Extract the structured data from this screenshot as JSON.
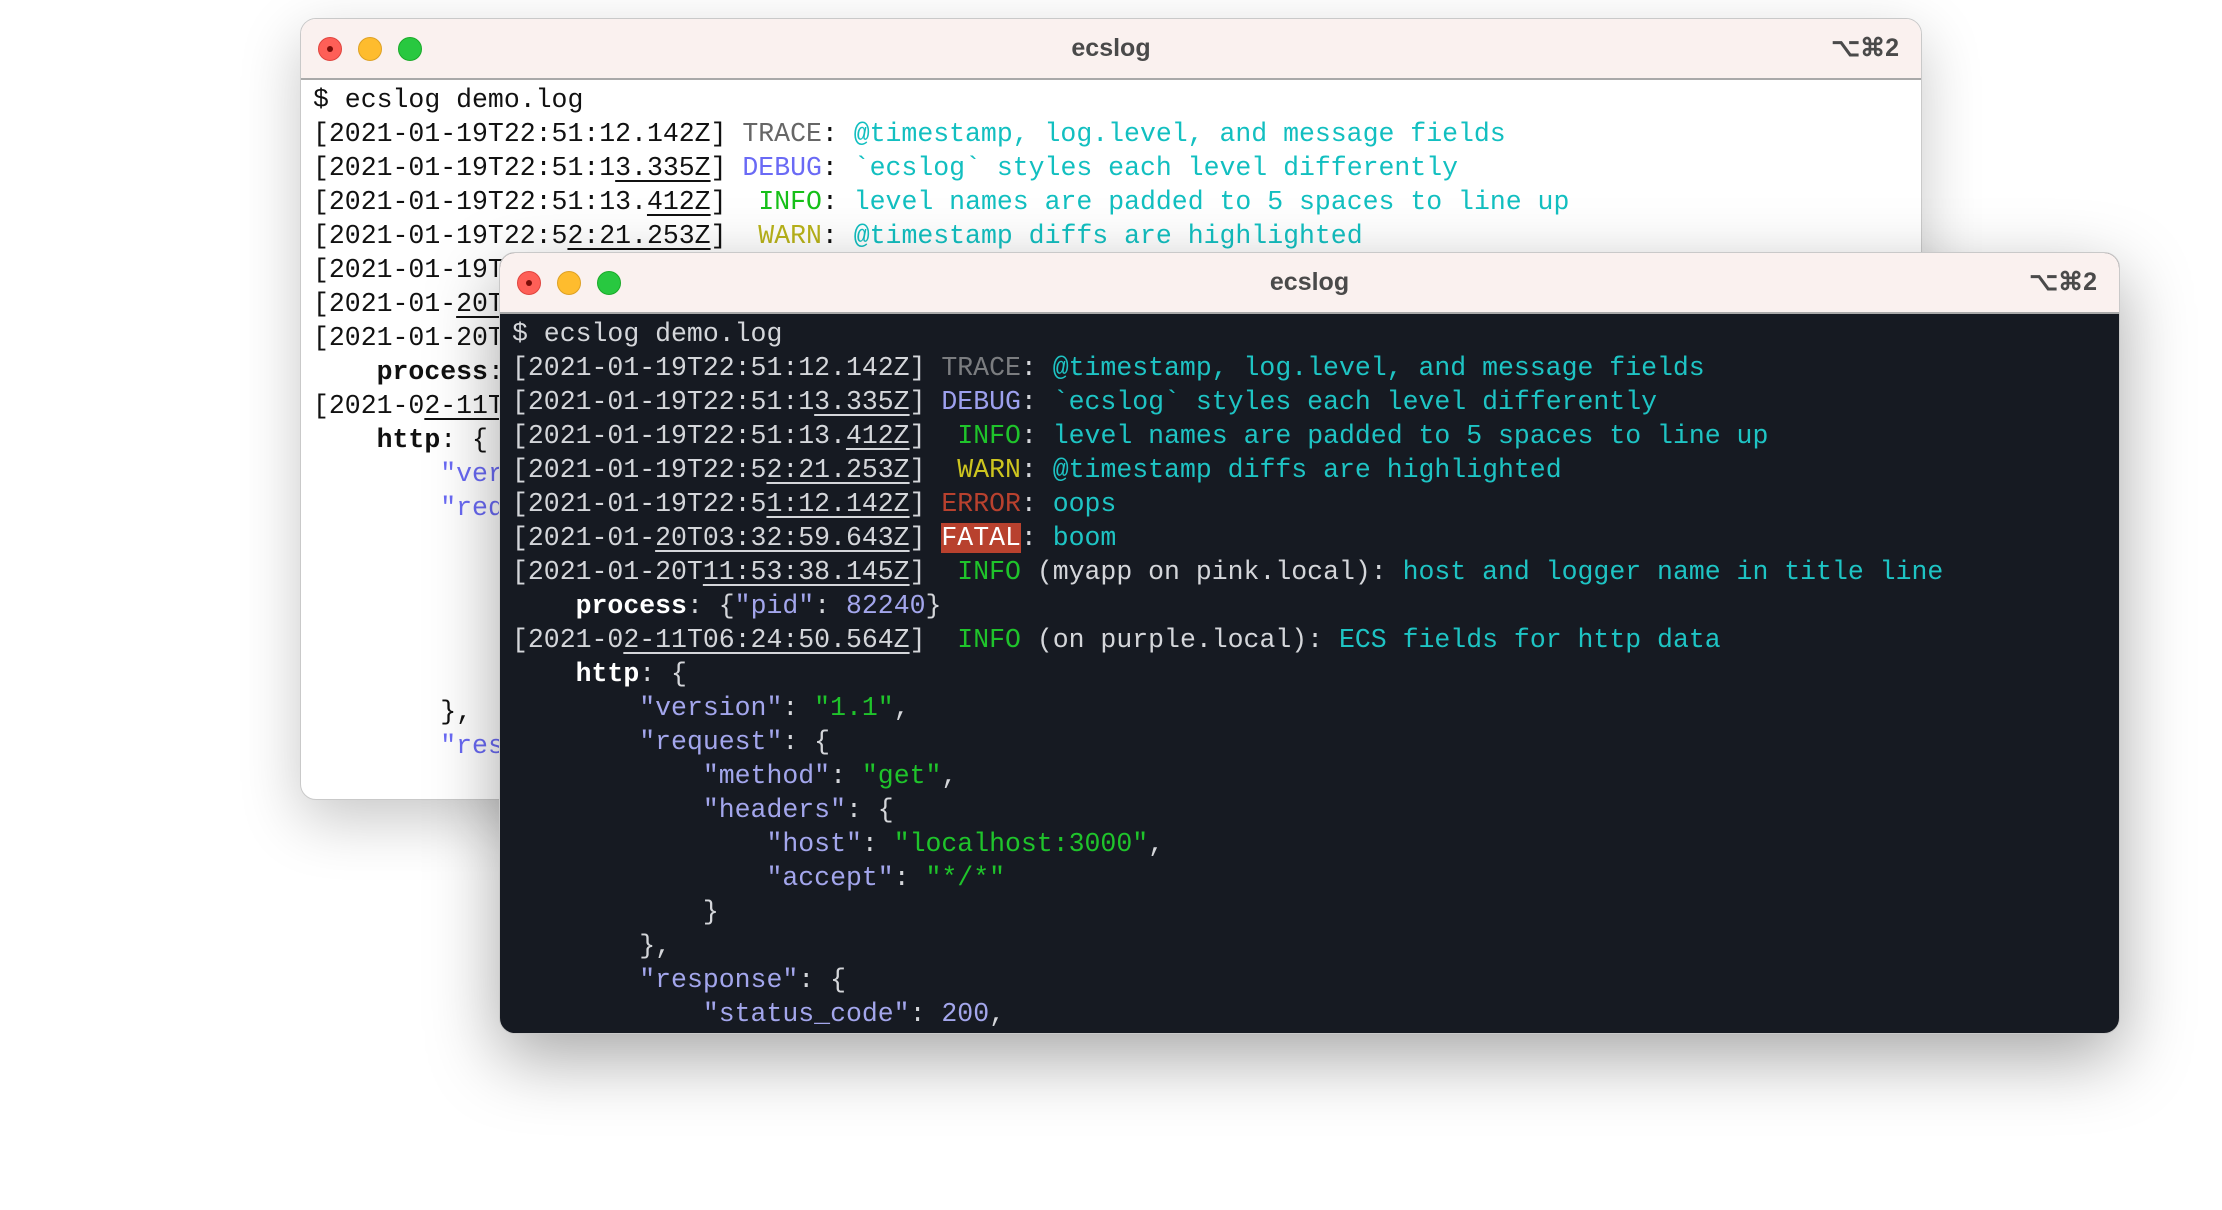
{
  "window": {
    "title": "ecslog",
    "shortcut": "⌥⌘2",
    "buttons": [
      "close",
      "minimize",
      "zoom"
    ]
  },
  "colors": {
    "dark_background": "#161a22",
    "light_background": "#ffffff",
    "titlebar": "#faf1ef",
    "trace": "#7b7d80",
    "debug": "#9da0ee",
    "info": "#1fc42b",
    "warn": "#cdc51f",
    "error": "#b8412e",
    "fatal_bg": "#b8412e",
    "message": "#1ec4c4"
  },
  "terminal": {
    "lines": [
      [
        [
          "$ ecslog demo.log",
          "plain"
        ]
      ],
      [
        [
          "[2021-01-19T22:51:12.142Z]",
          "ts"
        ],
        [
          " ",
          "plain"
        ],
        [
          "TRACE",
          "trace"
        ],
        [
          ": ",
          "punc"
        ],
        [
          "@timestamp, log.level, and message fields",
          "msg"
        ]
      ],
      [
        [
          "[2021-01-19T22:51:1",
          "ts"
        ],
        [
          "3.335Z",
          "tsu"
        ],
        [
          "]",
          "ts"
        ],
        [
          " ",
          "plain"
        ],
        [
          "DEBUG",
          "debug"
        ],
        [
          ": ",
          "punc"
        ],
        [
          "`ecslog` styles each level differently",
          "msg"
        ]
      ],
      [
        [
          "[2021-01-19T22:51:13.",
          "ts"
        ],
        [
          "412Z",
          "tsu"
        ],
        [
          "]",
          "ts"
        ],
        [
          "  ",
          "plain"
        ],
        [
          "INFO",
          "info"
        ],
        [
          ": ",
          "punc"
        ],
        [
          "level names are padded to 5 spaces to line up",
          "msg"
        ]
      ],
      [
        [
          "[2021-01-19T22:5",
          "ts"
        ],
        [
          "2:21.253Z",
          "tsu"
        ],
        [
          "]",
          "ts"
        ],
        [
          "  ",
          "plain"
        ],
        [
          "WARN",
          "warn"
        ],
        [
          ": ",
          "punc"
        ],
        [
          "@timestamp diffs are highlighted",
          "msg"
        ]
      ],
      [
        [
          "[2021-01-19T22:5",
          "ts"
        ],
        [
          "1:12.142Z",
          "tsu"
        ],
        [
          "]",
          "ts"
        ],
        [
          " ",
          "plain"
        ],
        [
          "ERROR",
          "error"
        ],
        [
          ": ",
          "punc"
        ],
        [
          "oops",
          "msg"
        ]
      ],
      [
        [
          "[2021-01-",
          "ts"
        ],
        [
          "20T03:32:59.643Z",
          "tsu"
        ],
        [
          "]",
          "ts"
        ],
        [
          " ",
          "plain"
        ],
        [
          "FATAL",
          "fatal"
        ],
        [
          ": ",
          "punc"
        ],
        [
          "boom",
          "msg"
        ]
      ],
      [
        [
          "[2021-01-20T",
          "ts"
        ],
        [
          "11:53:38.145Z",
          "tsu"
        ],
        [
          "]",
          "ts"
        ],
        [
          "  ",
          "plain"
        ],
        [
          "INFO",
          "info"
        ],
        [
          " (myapp on pink.local): ",
          "plain"
        ],
        [
          "host and logger name in title line",
          "msg"
        ]
      ],
      [
        [
          "    ",
          "plain"
        ],
        [
          "process",
          "key"
        ],
        [
          ": {",
          "punc"
        ],
        [
          "\"pid\"",
          "jkey"
        ],
        [
          ": ",
          "punc"
        ],
        [
          "82240",
          "jnum"
        ],
        [
          "}",
          "punc"
        ]
      ],
      [
        [
          "[2021-0",
          "ts"
        ],
        [
          "2-11T06:24:50.564Z",
          "tsu"
        ],
        [
          "]",
          "ts"
        ],
        [
          "  ",
          "plain"
        ],
        [
          "INFO",
          "info"
        ],
        [
          " (on purple.local): ",
          "plain"
        ],
        [
          "ECS fields for http data",
          "msg"
        ]
      ],
      [
        [
          "    ",
          "plain"
        ],
        [
          "http",
          "key"
        ],
        [
          ": {",
          "punc"
        ]
      ],
      [
        [
          "        ",
          "plain"
        ],
        [
          "\"version\"",
          "jkey"
        ],
        [
          ": ",
          "punc"
        ],
        [
          "\"1.1\"",
          "jstr"
        ],
        [
          ",",
          "punc"
        ]
      ],
      [
        [
          "        ",
          "plain"
        ],
        [
          "\"request\"",
          "jkey"
        ],
        [
          ": {",
          "punc"
        ]
      ],
      [
        [
          "            ",
          "plain"
        ],
        [
          "\"method\"",
          "jkey"
        ],
        [
          ": ",
          "punc"
        ],
        [
          "\"get\"",
          "jstr"
        ],
        [
          ",",
          "punc"
        ]
      ],
      [
        [
          "            ",
          "plain"
        ],
        [
          "\"headers\"",
          "jkey"
        ],
        [
          ": {",
          "punc"
        ]
      ],
      [
        [
          "                ",
          "plain"
        ],
        [
          "\"host\"",
          "jkey"
        ],
        [
          ": ",
          "punc"
        ],
        [
          "\"localhost:3000\"",
          "jstr"
        ],
        [
          ",",
          "punc"
        ]
      ],
      [
        [
          "                ",
          "plain"
        ],
        [
          "\"accept\"",
          "jkey"
        ],
        [
          ": ",
          "punc"
        ],
        [
          "\"*/*\"",
          "jstr"
        ]
      ],
      [
        [
          "            }",
          "punc"
        ]
      ],
      [
        [
          "        },",
          "punc"
        ]
      ],
      [
        [
          "        ",
          "plain"
        ],
        [
          "\"response\"",
          "jkey"
        ],
        [
          ": {",
          "punc"
        ]
      ],
      [
        [
          "            ",
          "plain"
        ],
        [
          "\"status_code\"",
          "jkey"
        ],
        [
          ": ",
          "punc"
        ],
        [
          "200",
          "jnum"
        ],
        [
          ",",
          "punc"
        ]
      ]
    ]
  }
}
